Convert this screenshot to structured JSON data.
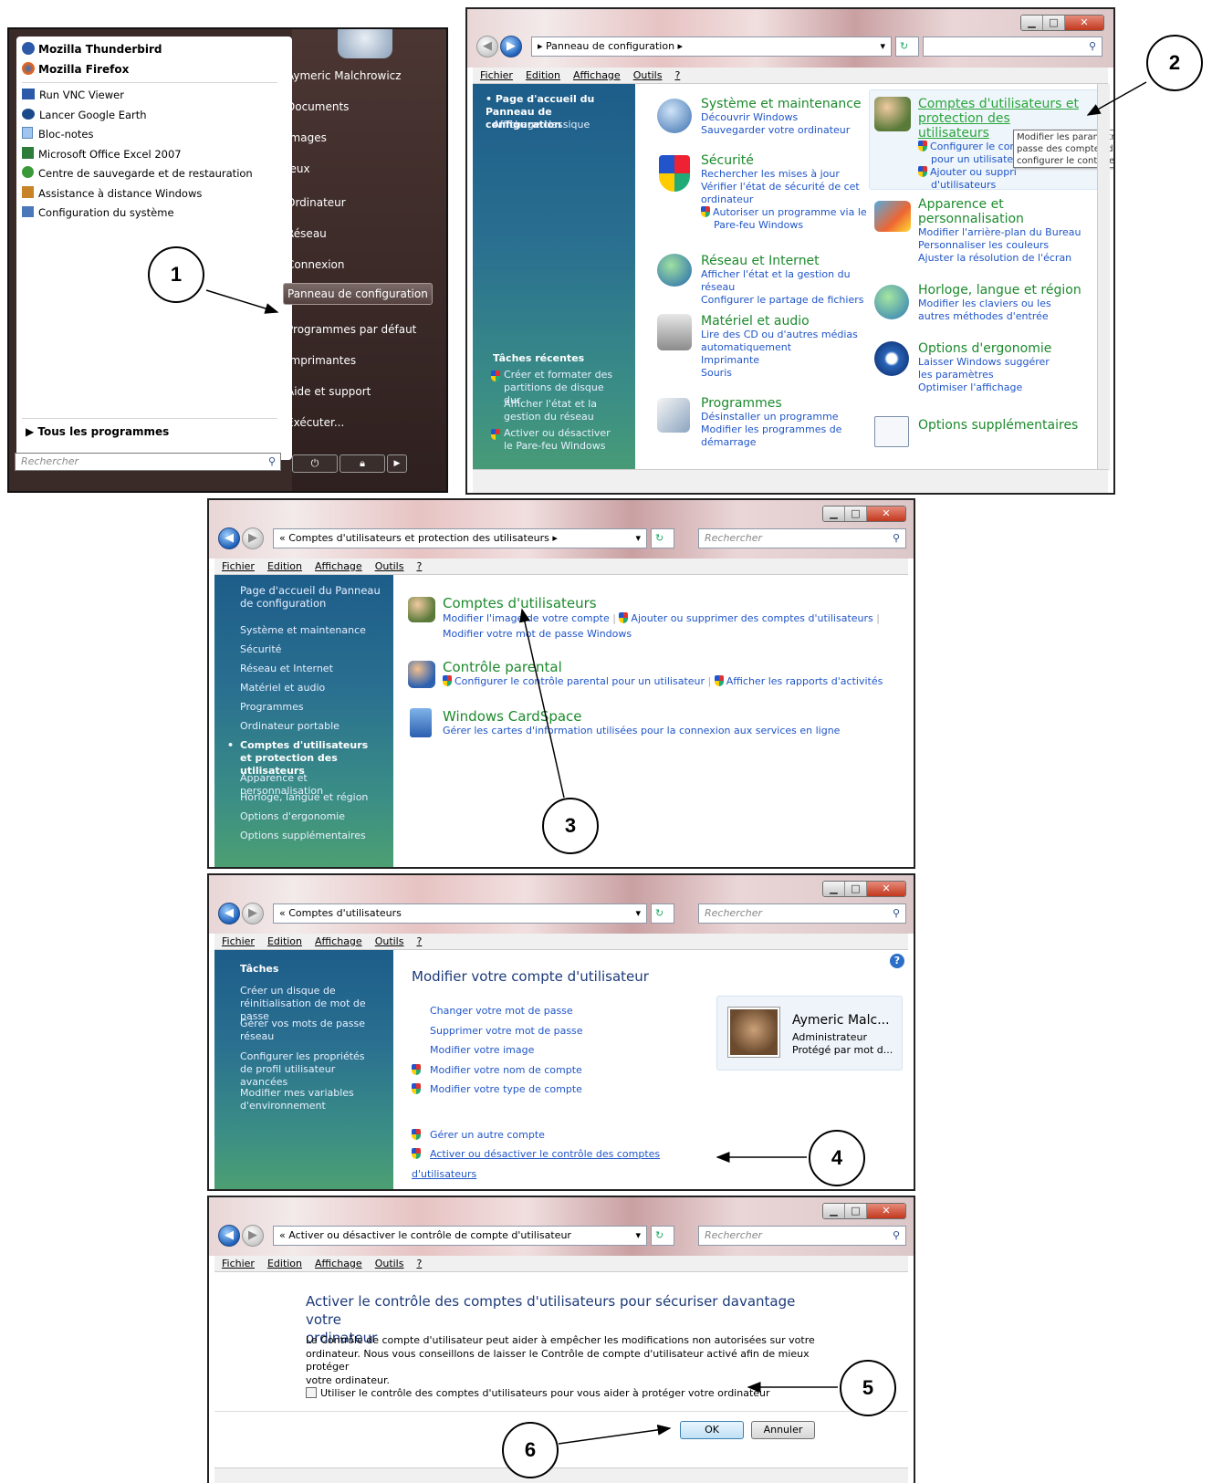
{
  "start_menu": {
    "pinned": [
      "Mozilla Thunderbird",
      "Mozilla Firefox"
    ],
    "recent": [
      "Run VNC Viewer",
      "Lancer Google Earth",
      "Bloc-notes",
      "Microsoft Office Excel 2007",
      "Centre de sauvegarde et de restauration",
      "Assistance à distance Windows",
      "Configuration du système"
    ],
    "all_programs": "Tous les programmes",
    "search_placeholder": "Rechercher",
    "right_items": [
      "Aymeric Malchrowicz",
      "Documents",
      "Images",
      "Jeux",
      "Ordinateur",
      "Réseau",
      "Connexion",
      "Panneau de configuration",
      "Programmes par défaut",
      "Imprimantes",
      "Aide et support",
      "Exécuter..."
    ],
    "highlighted_item": "Panneau de configuration"
  },
  "menubar": [
    "Fichier",
    "Edition",
    "Affichage",
    "Outils",
    "?"
  ],
  "search_placeholder": "Rechercher",
  "window2": {
    "address": "Panneau de configuration",
    "left_home": "Page d'accueil du Panneau de configuration",
    "left_classic": "Affichage classique",
    "recent_title": "Tâches récentes",
    "recent_tasks": [
      "Créer et formater des partitions de disque dur",
      "Afficher l'état et la gestion du réseau",
      "Activer ou désactiver le Pare-feu Windows"
    ],
    "categories": [
      {
        "title": "Système et maintenance",
        "links": [
          "Découvrir Windows",
          "Sauvegarder votre ordinateur"
        ]
      },
      {
        "title": "Sécurité",
        "links": [
          "Rechercher les mises à jour",
          "Vérifier l'état de sécurité de cet ordinateur",
          "Autoriser un programme via le Pare-feu Windows"
        ]
      },
      {
        "title": "Réseau et Internet",
        "links": [
          "Afficher l'état et la gestion du réseau",
          "Configurer le partage de fichiers"
        ]
      },
      {
        "title": "Matériel et audio",
        "links": [
          "Lire des CD ou d'autres médias automatiquement",
          "Imprimante",
          "Souris"
        ]
      },
      {
        "title": "Programmes",
        "links": [
          "Désinstaller un programme",
          "Modifier les programmes de démarrage"
        ]
      },
      {
        "title": "Comptes d'utilisateurs et protection des utilisateurs",
        "links": [
          "Configurer le con",
          "pour un utilisateu",
          "Ajouter ou suppri",
          "d'utilisateurs"
        ]
      },
      {
        "title": "Apparence et personnalisation",
        "links": [
          "Modifier l'arrière-plan du Bureau",
          "Personnaliser les couleurs",
          "Ajuster la résolution de l'écran"
        ]
      },
      {
        "title": "Horloge, langue et région",
        "links": [
          "Modifier les claviers ou les autres méthodes d'entrée"
        ]
      },
      {
        "title": "Options d'ergonomie",
        "links": [
          "Laisser Windows suggérer les paramètres",
          "Optimiser l'affichage"
        ]
      },
      {
        "title": "Options supplémentaires",
        "links": []
      }
    ],
    "tooltip": [
      "Modifier les paramètres",
      "passe des comptes d'uti",
      "configurer le contrôle pa"
    ]
  },
  "window3": {
    "address": "Comptes d'utilisateurs et protection des utilisateurs",
    "left": [
      "Page d'accueil du Panneau de configuration",
      "Système et maintenance",
      "Sécurité",
      "Réseau et Internet",
      "Matériel et audio",
      "Programmes",
      "Ordinateur portable",
      "Comptes d'utilisateurs et protection des utilisateurs",
      "Apparence et personnalisation",
      "Horloge, langue et région",
      "Options d'ergonomie",
      "Options supplémentaires"
    ],
    "sections": [
      {
        "title": "Comptes d'utilisateurs",
        "links": [
          "Modifier l'image de votre compte",
          "Ajouter ou supprimer des comptes d'utilisateurs",
          "Modifier votre mot de passe Windows"
        ]
      },
      {
        "title": "Contrôle parental",
        "links": [
          "Configurer le contrôle parental pour un utilisateur",
          "Afficher les rapports d'activités"
        ]
      },
      {
        "title": "Windows CardSpace",
        "links": [
          "Gérer les cartes d'information utilisées pour la connexion aux services en ligne"
        ]
      }
    ]
  },
  "window4": {
    "address": "Comptes d'utilisateurs",
    "tasks_title": "Tâches",
    "tasks": [
      "Créer un disque de réinitialisation de mot de passe",
      "Gérer vos mots de passe réseau",
      "Configurer les propriétés de profil utilisateur avancées",
      "Modifier mes variables d'environnement"
    ],
    "heading": "Modifier votre compte d'utilisateur",
    "links": [
      "Changer votre mot de passe",
      "Supprimer votre mot de passe",
      "Modifier votre image",
      "Modifier votre nom de compte",
      "Modifier votre type de compte"
    ],
    "links2": [
      "Gérer un autre compte",
      "Activer ou désactiver le contrôle des comptes d'utilisateurs"
    ],
    "user": {
      "name": "Aymeric Malc...",
      "role": "Administrateur",
      "status": "Protégé par mot d..."
    }
  },
  "window5": {
    "address": "Activer ou désactiver le contrôle de compte d'utilisateur",
    "heading_line1": "Activer le contrôle des comptes d'utilisateurs pour sécuriser davantage votre",
    "heading_line2": "ordinateur",
    "body": [
      "Le Contrôle de compte d'utilisateur peut aider à empêcher les modifications non autorisées sur votre",
      "ordinateur. Nous vous conseillons de laisser le Contrôle de compte d'utilisateur activé afin de mieux protéger",
      "votre ordinateur."
    ],
    "checkbox_label": "Utiliser le contrôle des comptes d'utilisateurs pour vous aider à protéger votre ordinateur",
    "checkbox_checked": false,
    "ok": "OK",
    "cancel": "Annuler"
  },
  "callouts": [
    "1",
    "2",
    "3",
    "4",
    "5",
    "6"
  ]
}
